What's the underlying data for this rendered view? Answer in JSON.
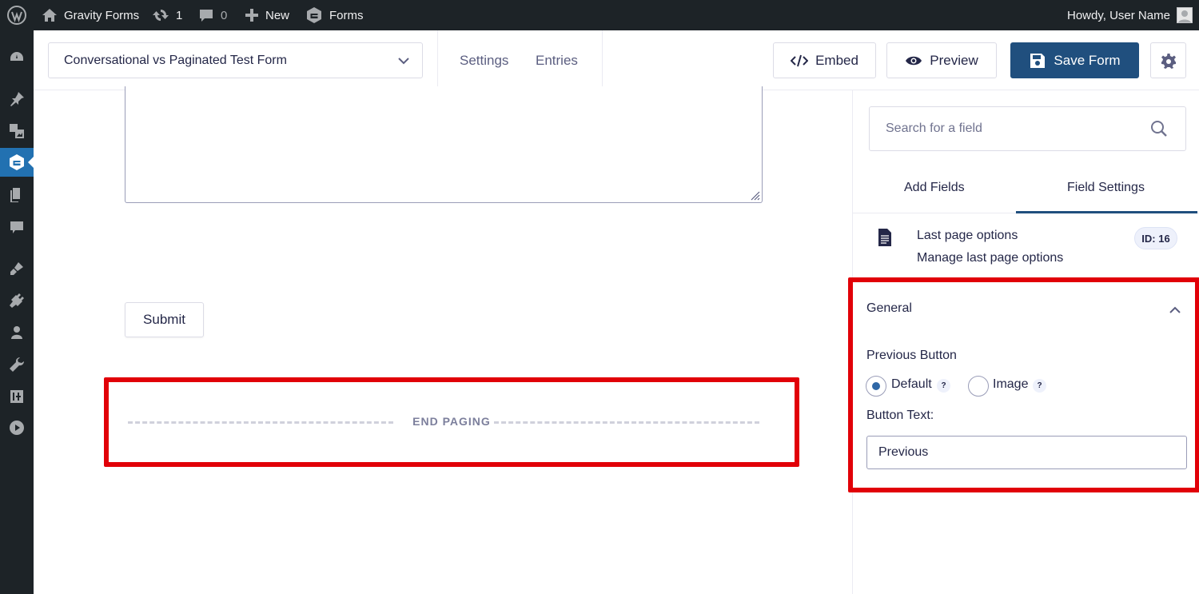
{
  "adminbar": {
    "site_name": "Gravity Forms",
    "updates_count": "1",
    "comments_count": "0",
    "new_label": "New",
    "forms_label": "Forms",
    "howdy": "Howdy, User Name"
  },
  "toolbar": {
    "form_title": "Conversational vs Paginated Test Form",
    "settings_label": "Settings",
    "entries_label": "Entries",
    "embed_label": "Embed",
    "preview_label": "Preview",
    "save_label": "Save Form"
  },
  "editor": {
    "submit_label": "Submit",
    "end_paging_label": "END PAGING"
  },
  "panel": {
    "search_placeholder": "Search for a field",
    "tabs": [
      "Add Fields",
      "Field Settings"
    ],
    "field_title": "Last page options",
    "field_desc": "Manage last page options",
    "field_id": "ID: 16",
    "section_title": "General",
    "previous_button_label": "Previous Button",
    "radio_default": "Default",
    "radio_image": "Image",
    "help_mark": "?",
    "button_text_label": "Button Text:",
    "button_text_value": "Previous"
  },
  "colors": {
    "admin_bar": "#1d2327",
    "accent": "#204f7e",
    "highlight": "#e10008",
    "active_menu": "#2271b1"
  }
}
